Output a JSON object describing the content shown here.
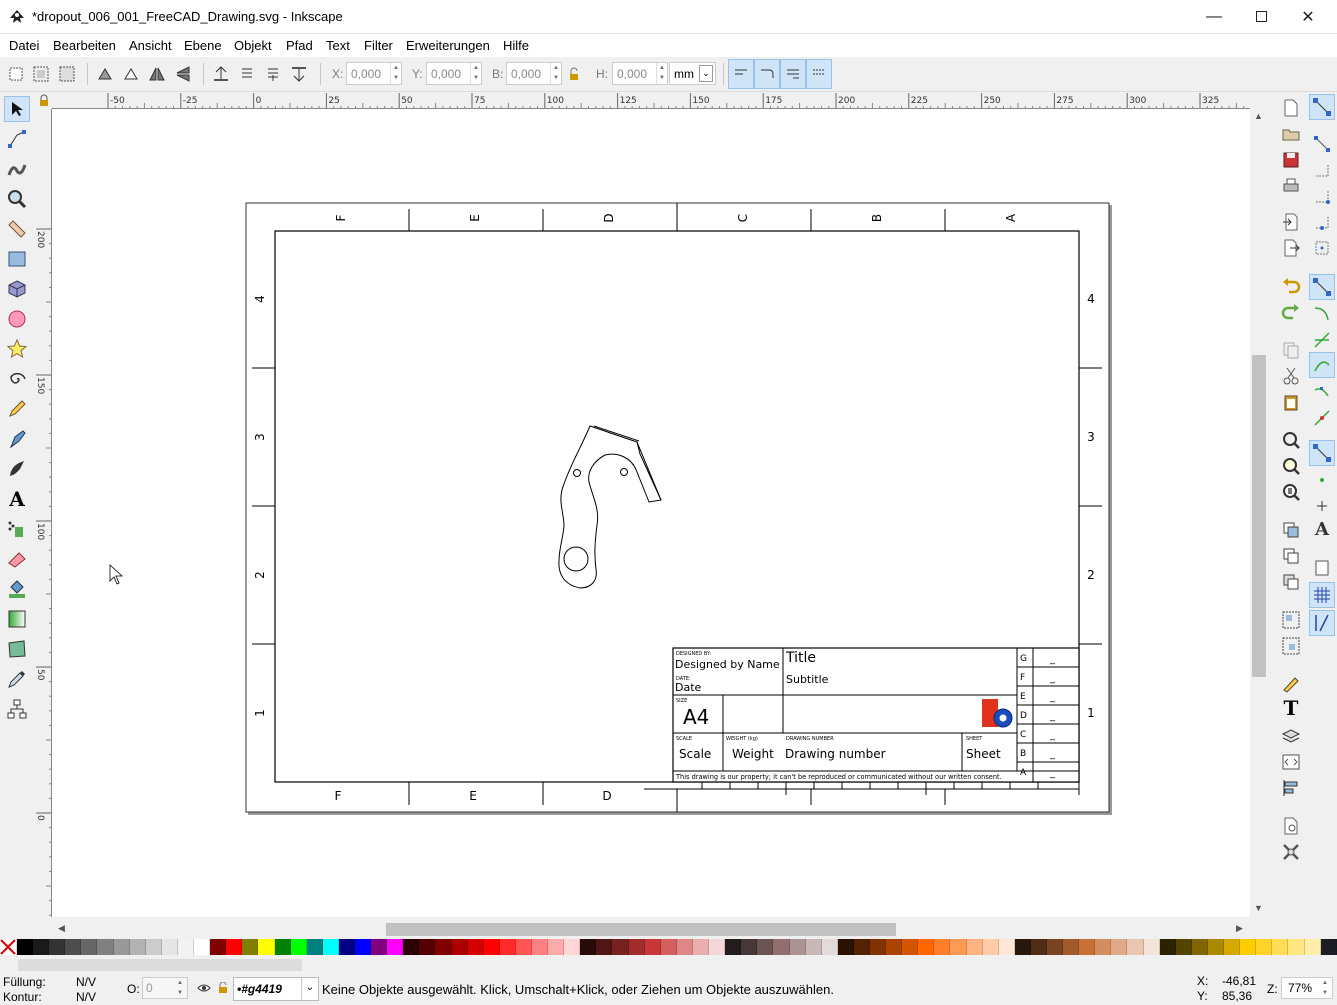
{
  "window": {
    "title": "*dropout_006_001_FreeCAD_Drawing.svg - Inkscape"
  },
  "menu": [
    "Datei",
    "Bearbeiten",
    "Ansicht",
    "Ebene",
    "Objekt",
    "Pfad",
    "Text",
    "Filter",
    "Erweiterungen",
    "Hilfe"
  ],
  "toolbar": {
    "x_label": "X:",
    "x_value": "0,000",
    "y_label": "Y:",
    "y_value": "0,000",
    "w_label": "B:",
    "w_value": "0,000",
    "h_label": "H:",
    "h_value": "0,000",
    "unit": "mm"
  },
  "ruler": {
    "h_ticks": [
      "-50",
      "-25",
      "0",
      "25",
      "50",
      "75",
      "100",
      "125",
      "150",
      "175",
      "200",
      "225",
      "250",
      "275",
      "300",
      "325"
    ],
    "v_ticks": [
      "200",
      "150",
      "100",
      "50",
      "0"
    ]
  },
  "drawing": {
    "top_cols": [
      "F",
      "E",
      "D",
      "C",
      "B",
      "A"
    ],
    "bottom_cols": [
      "F",
      "E",
      "D"
    ],
    "rows": [
      "4",
      "3",
      "2",
      "1"
    ],
    "title_block": {
      "designed_by_lbl": "DESIGNED BY:",
      "designed_by": "Designed by Name",
      "date_lbl": "DATE:",
      "date": "Date",
      "title": "Title",
      "subtitle": "Subtitle",
      "size_lbl": "SIZE",
      "size": "A4",
      "scale_lbl": "SCALE",
      "scale": "Scale",
      "weight_lbl": "WEIGHT (kg)",
      "weight": "Weight",
      "drawing_number_lbl": "DRAWING NUMBER",
      "drawing_number": "Drawing number",
      "sheet_lbl": "SHEET",
      "sheet": "Sheet",
      "revision_letters": [
        "G",
        "F",
        "E",
        "D",
        "C",
        "B",
        "A"
      ],
      "revision_value": "_",
      "footer": "This drawing is our property; it can't be reproduced or communicated without our written consent."
    }
  },
  "palette": [
    "#000000",
    "#1a1a1a",
    "#333333",
    "#4d4d4d",
    "#666666",
    "#808080",
    "#999999",
    "#b3b3b3",
    "#cccccc",
    "#e6e6e6",
    "#f2f2f2",
    "#ffffff",
    "#800000",
    "#ff0000",
    "#808000",
    "#ffff00",
    "#008000",
    "#00ff00",
    "#008080",
    "#00ffff",
    "#000080",
    "#0000ff",
    "#800080",
    "#ff00ff",
    "#2b0000",
    "#550000",
    "#800000",
    "#aa0000",
    "#d40000",
    "#ff0000",
    "#ff2a2a",
    "#ff5555",
    "#ff8080",
    "#ffaaaa",
    "#ffd5d5",
    "#280b0b",
    "#501616",
    "#782121",
    "#a02c2c",
    "#c83737",
    "#d35f5f",
    "#de8787",
    "#e9afaf",
    "#f4d7d7",
    "#241c1c",
    "#483737",
    "#6c5353",
    "#916f6f",
    "#ac9393",
    "#c8b7b7",
    "#e3dbdb",
    "#2b1100",
    "#552200",
    "#803300",
    "#aa4400",
    "#d45500",
    "#ff6600",
    "#ff7f2a",
    "#ff9955",
    "#ffb380",
    "#ffccaa",
    "#ffe6d5",
    "#28170b",
    "#502d16",
    "#784421",
    "#a05a2c",
    "#c87137",
    "#d38d5f",
    "#deaa87",
    "#e9c6af",
    "#f4e3d7",
    "#2b2200",
    "#554400",
    "#806600",
    "#aa8800",
    "#d4aa00",
    "#ffcc00",
    "#ffd42a",
    "#ffdd55",
    "#ffe680",
    "#ffeeaa",
    "#1c1c24"
  ],
  "status": {
    "fill_lbl": "Füllung:",
    "fill_val": "N/V",
    "stroke_lbl": "Kontur:",
    "stroke_val": "N/V",
    "opacity_lbl": "O:",
    "opacity_val": "0",
    "layer": "•#g4419",
    "message": "Keine Objekte ausgewählt. Klick, Umschalt+Klick, oder Ziehen um Objekte auszuwählen.",
    "x_lbl": "X:",
    "x_val": "-46,81",
    "y_lbl": "Y:",
    "y_val": "85,36",
    "zoom_lbl": "Z:",
    "zoom_val": "77%"
  }
}
